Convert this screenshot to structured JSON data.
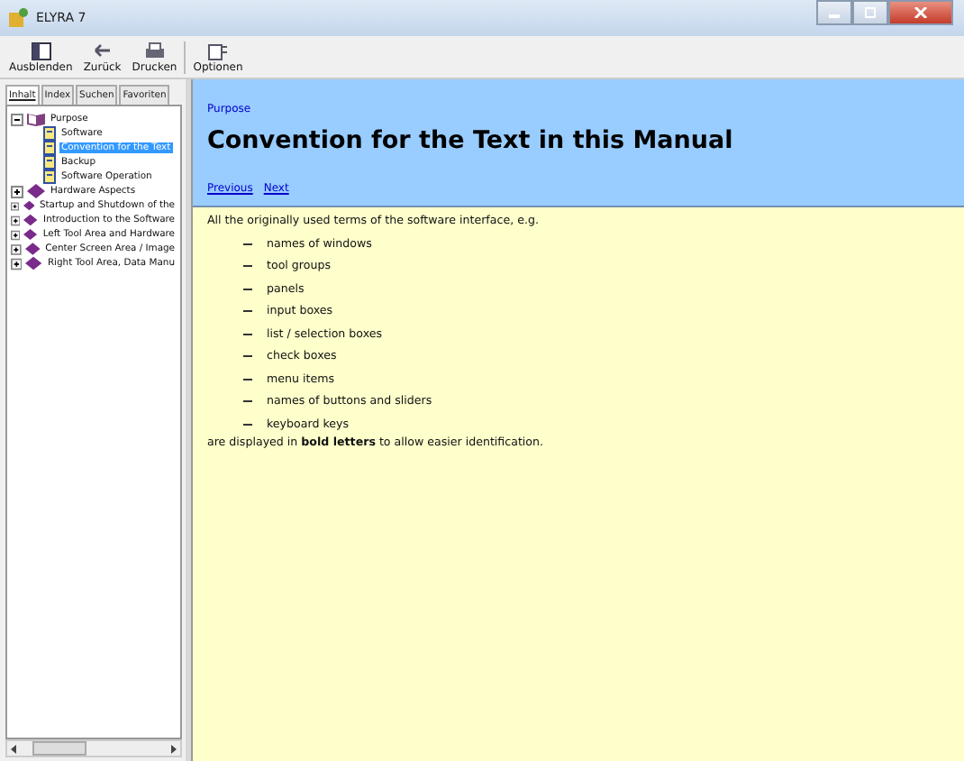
{
  "window": {
    "title": "ELYRA 7"
  },
  "toolbar": [
    {
      "label": "Ausblenden",
      "kind": "hide"
    },
    {
      "label": "Zurück",
      "kind": "back"
    },
    {
      "label": "Drucken",
      "kind": "print"
    },
    {
      "label": "Optionen",
      "kind": "options"
    }
  ],
  "tabs": [
    {
      "label": "Inhalt",
      "selected": true
    },
    {
      "label": "Index",
      "selected": false
    },
    {
      "label": "Suchen",
      "selected": false
    },
    {
      "label": "Favoriten",
      "selected": false
    }
  ],
  "tree": [
    {
      "label": "Purpose",
      "expanded": true,
      "children": [
        {
          "label": "Software",
          "selected": false
        },
        {
          "label": "Convention for the Text",
          "selected": true
        },
        {
          "label": "Backup",
          "selected": false
        },
        {
          "label": "Software Operation",
          "selected": false
        }
      ]
    },
    {
      "label": "Hardware Aspects",
      "expanded": false
    },
    {
      "label": "Startup and Shutdown of the",
      "expanded": false
    },
    {
      "label": "Introduction to the Software",
      "expanded": false
    },
    {
      "label": "Left Tool Area and Hardware",
      "expanded": false
    },
    {
      "label": "Center Screen Area / Image",
      "expanded": false
    },
    {
      "label": "Right Tool Area, Data Manu",
      "expanded": false
    }
  ],
  "page": {
    "breadcrumb": "Purpose",
    "heading": "Convention for the Text in this Manual",
    "nav": [
      "Previous",
      "Next"
    ],
    "intro": "All the originally used terms of the software interface, e.g.",
    "items": [
      "names of windows",
      "tool groups",
      "panels",
      "input boxes",
      "list / selection boxes",
      "check boxes",
      "menu items",
      "names of buttons and sliders",
      "keyboard keys"
    ],
    "outro": "are displayed in **bold letters** to allow easier identification."
  }
}
